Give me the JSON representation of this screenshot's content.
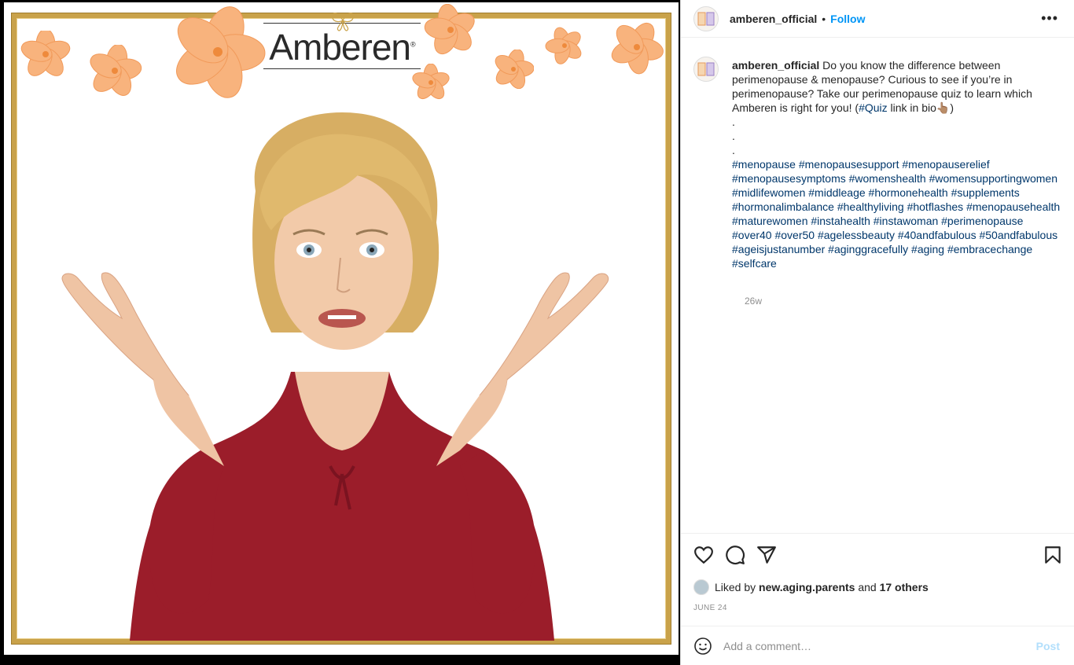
{
  "post": {
    "username": "amberen_official",
    "follow_label": "Follow",
    "header_separator": "•",
    "more_label": "•••",
    "brand_name": "Amberen",
    "brand_mark": "®",
    "caption": {
      "username": "amberen_official",
      "text_1": "Do you know the difference between perimenopause & menopause? Curious to see if you’re in perimenopause? Take our perimenopause quiz to learn which Amberen is right for you! (",
      "quiz_tag": "#Quiz",
      "text_2": " link in bio",
      "pointing_emoji": "👆🏽",
      "text_3": ")",
      "dots": [
        ".",
        ".",
        "."
      ],
      "hashtags": "#menopause #menopausesupport #menopauserelief #menopausesymptoms #womenshealth #womensupportingwomen #midlifewomen #middleage #hormonehealth #supplements #hormonalimbalance #healthyliving #hotflashes #menopausehealth #maturewomen #instahealth #instawoman #perimenopause #over40 #over50 #agelessbeauty #40andfabulous #50andfabulous #ageisjustanumber #aginggracefully #aging #embracechange #selfcare"
    },
    "time_ago": "26w",
    "likes": {
      "prefix": "Liked by ",
      "user": "new.aging.parents",
      "middle": " and ",
      "others": "17 others"
    },
    "date": "JUNE 24",
    "comment": {
      "placeholder": "Add a comment…",
      "post_label": "Post"
    }
  },
  "colors": {
    "link_blue": "#0095f6",
    "hashtag": "#00376b",
    "gold_frame": "#c9a24a",
    "flower": "#f7b27a",
    "shirt": "#9b1d2a"
  },
  "icons": [
    "heart-icon",
    "comment-icon",
    "share-icon",
    "bookmark-icon",
    "emoji-icon",
    "more-options-icon"
  ]
}
